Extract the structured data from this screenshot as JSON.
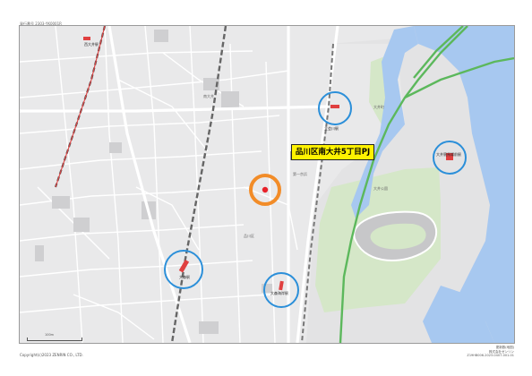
{
  "header": {
    "note": "発行番号  2303-YK0001R"
  },
  "project": {
    "label": "品川区南大井5丁目PJ"
  },
  "stations": [
    {
      "name": "立会川駅",
      "highlighted": true
    },
    {
      "name": "大井競馬場前駅",
      "highlighted": true
    },
    {
      "name": "大森駅",
      "highlighted": true
    },
    {
      "name": "大森海岸駅",
      "highlighted": true
    },
    {
      "name": "西大井駅",
      "highlighted": false
    }
  ],
  "place_labels": {
    "park": "大井公園",
    "area_east": "大井町",
    "shop": "品川区",
    "oi5": "南大井",
    "route": "第一京浜"
  },
  "scale": {
    "label": "100m"
  },
  "footer": {
    "copyright": "Copyright(c)2023 ZENRIN CO., LTD.",
    "right_line1": "更新数(地図)",
    "right_line2": "株式会社ゼンリン",
    "right_line3": "Z19HB006-2023-0407-001-01"
  },
  "colors": {
    "map_bg": "#e9e9ea",
    "water": "#a7c8f0",
    "park_green": "#d5e7c8",
    "highway": "#5cb85c",
    "station_circle": "#2b8fd9",
    "site_circle": "#f28c28",
    "site_dot": "#e8222a",
    "label_bg": "#fff200"
  }
}
